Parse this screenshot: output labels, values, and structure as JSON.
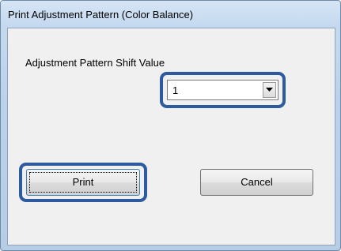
{
  "window": {
    "title": "Print Adjustment Pattern (Color Balance)"
  },
  "form": {
    "shift_label": "Adjustment Pattern Shift Value",
    "shift_value": "1"
  },
  "buttons": {
    "print_label": "Print",
    "cancel_label": "Cancel"
  },
  "colors": {
    "highlight": "#2e5b9e",
    "titlebar": "#c3d8ef",
    "client": "#f0f0f0"
  },
  "icons": {
    "dropdown": "chevron-down-icon"
  }
}
